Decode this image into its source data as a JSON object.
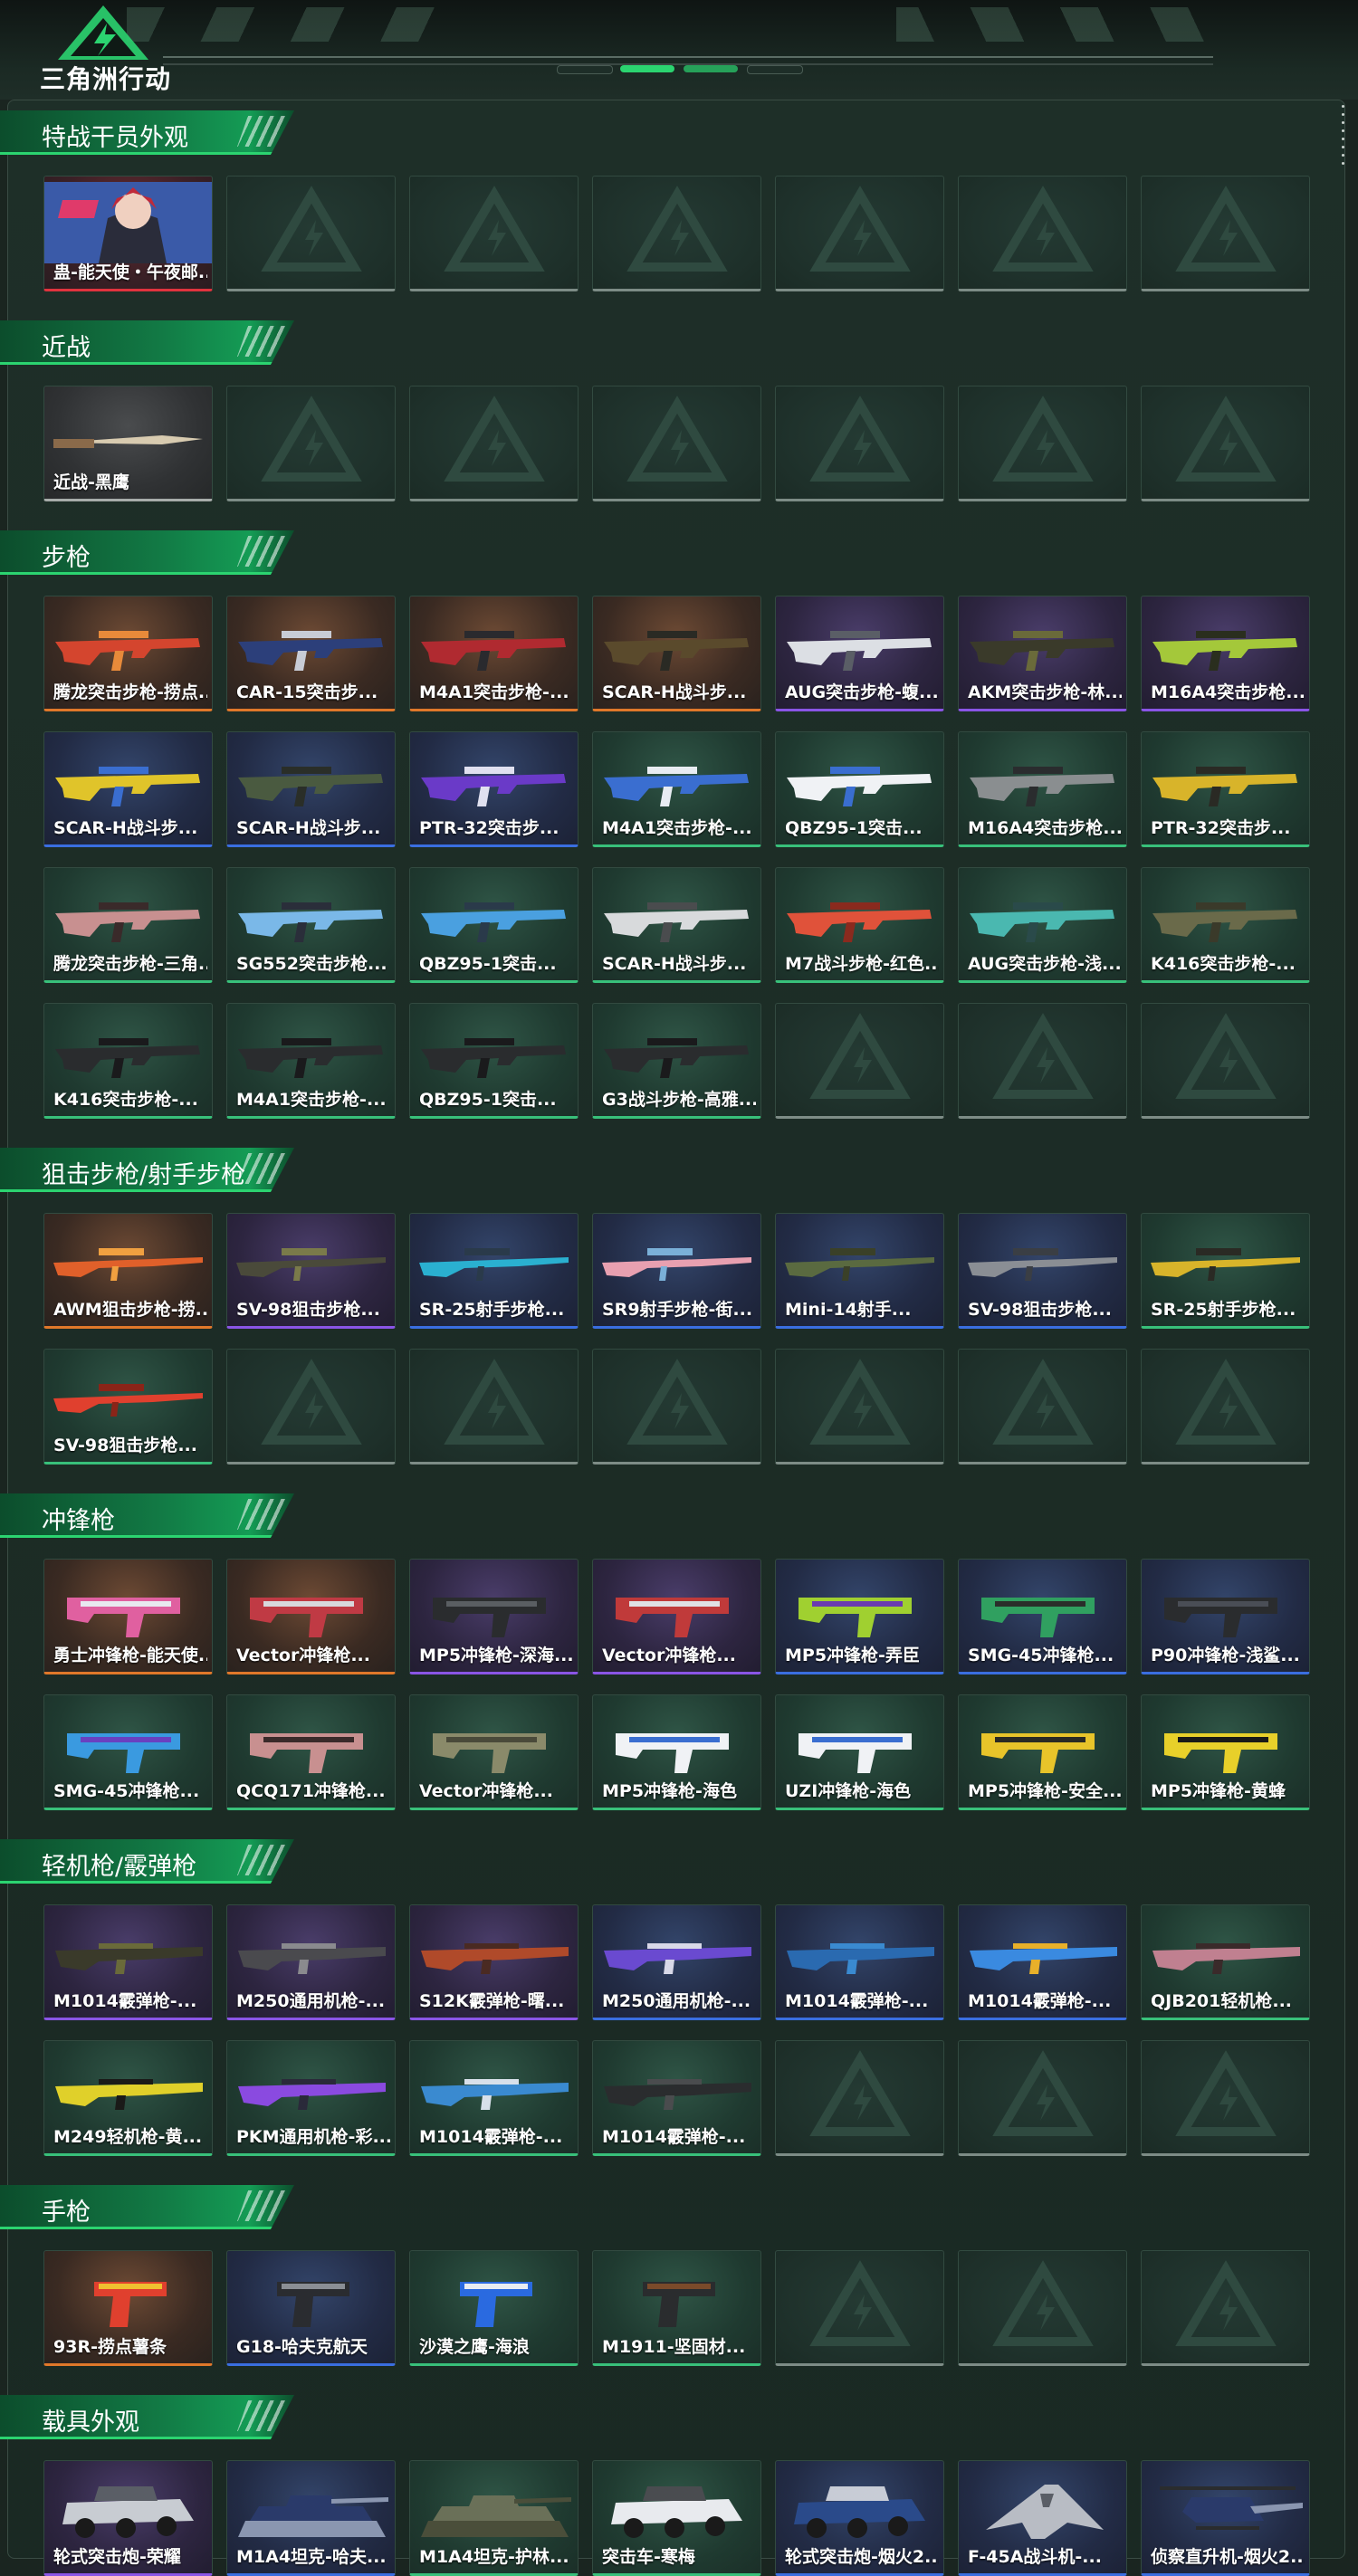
{
  "app": {
    "logo_text": "三角洲行动",
    "colors": {
      "accent": "#2bd470",
      "background": "#1a2520"
    }
  },
  "rarity_colors": {
    "orange": "#e0782a",
    "purple": "#8a55e6",
    "blue": "#3a6ee0",
    "green": "#38c07a",
    "red": "#e0333e",
    "gray": "#a7acaa",
    "empty": "#7d8c86"
  },
  "sections": [
    {
      "title": "特战干员外观",
      "slots": 7,
      "items": [
        {
          "name": "蛊-能天使・午夜邮...",
          "rarity": "red",
          "icon": "operator-portrait-icon"
        }
      ]
    },
    {
      "title": "近战",
      "slots": 7,
      "items": [
        {
          "name": "近战-黑鹰",
          "rarity": "gray",
          "icon": "knife-icon"
        }
      ]
    },
    {
      "title": "步枪",
      "slots": 28,
      "items": [
        {
          "name": "腾龙突击步枪-捞点...",
          "rarity": "orange",
          "icon": "rifle-icon",
          "colors": [
            "#d4452e",
            "#e88a3a"
          ]
        },
        {
          "name": "CAR-15突击步...",
          "rarity": "orange",
          "icon": "rifle-icon",
          "colors": [
            "#2c3f7a",
            "#c8ccd6"
          ]
        },
        {
          "name": "M4A1突击步枪-...",
          "rarity": "orange",
          "icon": "rifle-icon",
          "colors": [
            "#b02a30",
            "#2a2a2e"
          ]
        },
        {
          "name": "SCAR-H战斗步...",
          "rarity": "orange",
          "icon": "rifle-icon",
          "colors": [
            "#5a4a2c",
            "#2a2a24"
          ]
        },
        {
          "name": "AUG突击步枪-蝮...",
          "rarity": "purple",
          "icon": "rifle-icon",
          "colors": [
            "#dcdfe4",
            "#5a5e66"
          ]
        },
        {
          "name": "AKM突击步枪-林...",
          "rarity": "purple",
          "icon": "rifle-icon",
          "colors": [
            "#3a3a2a",
            "#6a6a3a"
          ]
        },
        {
          "name": "M16A4突击步枪...",
          "rarity": "purple",
          "icon": "rifle-icon",
          "colors": [
            "#a4c83a",
            "#2a2e1e"
          ]
        },
        {
          "name": "SCAR-H战斗步...",
          "rarity": "blue",
          "icon": "rifle-icon",
          "colors": [
            "#e0c42a",
            "#3a6ed0"
          ]
        },
        {
          "name": "SCAR-H战斗步...",
          "rarity": "blue",
          "icon": "rifle-icon",
          "colors": [
            "#4a5a40",
            "#2a2e28"
          ]
        },
        {
          "name": "PTR-32突击步...",
          "rarity": "blue",
          "icon": "rifle-icon",
          "colors": [
            "#6a3ac8",
            "#e0e0f0"
          ]
        },
        {
          "name": "M4A1突击步枪-...",
          "rarity": "green",
          "icon": "rifle-icon",
          "colors": [
            "#3a6ed0",
            "#e8ecf2"
          ]
        },
        {
          "name": "QBZ95-1突击...",
          "rarity": "green",
          "icon": "rifle-icon",
          "colors": [
            "#f0f2f5",
            "#3a6ed0"
          ]
        },
        {
          "name": "M16A4突击步枪...",
          "rarity": "green",
          "icon": "rifle-icon",
          "colors": [
            "#8a8e90",
            "#2a2c2e"
          ]
        },
        {
          "name": "PTR-32突击步...",
          "rarity": "green",
          "icon": "rifle-icon",
          "colors": [
            "#d8b42a",
            "#2a2a24"
          ]
        },
        {
          "name": "腾龙突击步枪-三角...",
          "rarity": "green",
          "icon": "rifle-icon",
          "colors": [
            "#c89090",
            "#3a2a2a"
          ]
        },
        {
          "name": "SG552突击步枪...",
          "rarity": "green",
          "icon": "rifle-icon",
          "colors": [
            "#7ab8e8",
            "#2a2e3a"
          ]
        },
        {
          "name": "QBZ95-1突击...",
          "rarity": "green",
          "icon": "rifle-icon",
          "colors": [
            "#4aa0e0",
            "#2a3a4a"
          ]
        },
        {
          "name": "SCAR-H战斗步...",
          "rarity": "green",
          "icon": "rifle-icon",
          "colors": [
            "#d8dadc",
            "#4a4c4e"
          ]
        },
        {
          "name": "M7战斗步枪-红色...",
          "rarity": "green",
          "icon": "rifle-icon",
          "colors": [
            "#e0523a",
            "#8a2a1e"
          ]
        },
        {
          "name": "AUG突击步枪-浅...",
          "rarity": "green",
          "icon": "rifle-icon",
          "colors": [
            "#4ab8b0",
            "#2a4a4a"
          ]
        },
        {
          "name": "K416突击步枪-...",
          "rarity": "green",
          "icon": "rifle-icon",
          "colors": [
            "#6a6a4a",
            "#3a3a2a"
          ]
        },
        {
          "name": "K416突击步枪-...",
          "rarity": "green",
          "icon": "rifle-icon",
          "colors": [
            "#2a2c2e",
            "#1a1a1c"
          ]
        },
        {
          "name": "M4A1突击步枪-...",
          "rarity": "green",
          "icon": "rifle-icon",
          "colors": [
            "#2a2c2e",
            "#1a1a1c"
          ]
        },
        {
          "name": "QBZ95-1突击...",
          "rarity": "green",
          "icon": "rifle-icon",
          "colors": [
            "#2a2c2e",
            "#1a1a1c"
          ]
        },
        {
          "name": "G3战斗步枪-高雅...",
          "rarity": "green",
          "icon": "rifle-icon",
          "colors": [
            "#2a2c2e",
            "#1a1a1c"
          ]
        }
      ]
    },
    {
      "title": "狙击步枪/射手步枪",
      "slots": 14,
      "items": [
        {
          "name": "AWM狙击步枪-捞...",
          "rarity": "orange",
          "icon": "sniper-rifle-icon",
          "colors": [
            "#e0602a",
            "#f0a040"
          ]
        },
        {
          "name": "SV-98狙击步枪...",
          "rarity": "purple",
          "icon": "sniper-rifle-icon",
          "colors": [
            "#4a4a3a",
            "#7a7a4a"
          ]
        },
        {
          "name": "SR-25射手步枪...",
          "rarity": "blue",
          "icon": "sniper-rifle-icon",
          "colors": [
            "#2ab0d0",
            "#2a3a4a"
          ]
        },
        {
          "name": "SR9射手步枪-街...",
          "rarity": "blue",
          "icon": "sniper-rifle-icon",
          "colors": [
            "#e8a0b0",
            "#7ab0d8"
          ]
        },
        {
          "name": "Mini-14射手...",
          "rarity": "blue",
          "icon": "sniper-rifle-icon",
          "colors": [
            "#5a6a40",
            "#3a4028"
          ]
        },
        {
          "name": "SV-98狙击步枪...",
          "rarity": "blue",
          "icon": "sniper-rifle-icon",
          "colors": [
            "#8a8e94",
            "#3a3e44"
          ]
        },
        {
          "name": "SR-25射手步枪...",
          "rarity": "green",
          "icon": "sniper-rifle-icon",
          "colors": [
            "#d8b42a",
            "#2a2a24"
          ]
        },
        {
          "name": "SV-98狙击步枪...",
          "rarity": "green",
          "icon": "sniper-rifle-icon",
          "colors": [
            "#e0402e",
            "#8a2418"
          ]
        }
      ]
    },
    {
      "title": "冲锋枪",
      "slots": 14,
      "items": [
        {
          "name": "勇士冲锋枪-能天使...",
          "rarity": "orange",
          "icon": "smg-icon",
          "colors": [
            "#e060a0",
            "#e8e8f0"
          ]
        },
        {
          "name": "Vector冲锋枪...",
          "rarity": "orange",
          "icon": "smg-icon",
          "colors": [
            "#c03a44",
            "#d8d8dc"
          ]
        },
        {
          "name": "MP5冲锋枪-深海...",
          "rarity": "purple",
          "icon": "smg-icon",
          "colors": [
            "#2a2c2e",
            "#5a5e62"
          ]
        },
        {
          "name": "Vector冲锋枪...",
          "rarity": "purple",
          "icon": "smg-icon",
          "colors": [
            "#c03a3a",
            "#e0e0e4"
          ]
        },
        {
          "name": "MP5冲锋枪-弄臣",
          "rarity": "blue",
          "icon": "smg-icon",
          "colors": [
            "#a0d030",
            "#6a3ab0"
          ]
        },
        {
          "name": "SMG-45冲锋枪...",
          "rarity": "blue",
          "icon": "smg-icon",
          "colors": [
            "#30a060",
            "#2a2e2a"
          ]
        },
        {
          "name": "P90冲锋枪-浅鲨...",
          "rarity": "blue",
          "icon": "smg-icon",
          "colors": [
            "#2a2c2e",
            "#4a4e56"
          ]
        },
        {
          "name": "SMG-45冲锋枪...",
          "rarity": "green",
          "icon": "smg-icon",
          "colors": [
            "#3a9ae0",
            "#6a40c0"
          ]
        },
        {
          "name": "QCQ171冲锋枪...",
          "rarity": "green",
          "icon": "smg-icon",
          "colors": [
            "#c89090",
            "#3a2a2a"
          ]
        },
        {
          "name": "Vector冲锋枪...",
          "rarity": "green",
          "icon": "smg-icon",
          "colors": [
            "#8a8a6a",
            "#4a4a3a"
          ]
        },
        {
          "name": "MP5冲锋枪-海色",
          "rarity": "green",
          "icon": "smg-icon",
          "colors": [
            "#f0f2f5",
            "#3a6ed0"
          ]
        },
        {
          "name": "UZI冲锋枪-海色",
          "rarity": "green",
          "icon": "smg-icon",
          "colors": [
            "#f0f2f5",
            "#3a6ed0"
          ]
        },
        {
          "name": "MP5冲锋枪-安全...",
          "rarity": "green",
          "icon": "smg-icon",
          "colors": [
            "#e8c42a",
            "#2a2a24"
          ]
        },
        {
          "name": "MP5冲锋枪-黄蜂",
          "rarity": "green",
          "icon": "smg-icon",
          "colors": [
            "#e8d02a",
            "#1a1a18"
          ]
        }
      ]
    },
    {
      "title": "轻机枪/霰弹枪",
      "slots": 14,
      "items": [
        {
          "name": "M1014霰弹枪-...",
          "rarity": "purple",
          "icon": "shotgun-icon",
          "colors": [
            "#3a3a2a",
            "#6a6a3a"
          ]
        },
        {
          "name": "M250通用机枪-...",
          "rarity": "purple",
          "icon": "machine-gun-icon",
          "colors": [
            "#4a4a4e",
            "#8a8a8e"
          ]
        },
        {
          "name": "S12K霰弹枪-曙...",
          "rarity": "purple",
          "icon": "shotgun-icon",
          "colors": [
            "#b04a2a",
            "#4a2a22"
          ]
        },
        {
          "name": "M250通用机枪-...",
          "rarity": "blue",
          "icon": "machine-gun-icon",
          "colors": [
            "#6a4ad0",
            "#d8d8e8"
          ]
        },
        {
          "name": "M1014霰弹枪-...",
          "rarity": "blue",
          "icon": "shotgun-icon",
          "colors": [
            "#2a6ab0",
            "#3a8ad0"
          ]
        },
        {
          "name": "M1014霰弹枪-...",
          "rarity": "blue",
          "icon": "shotgun-icon",
          "colors": [
            "#3a8ae0",
            "#e8b02a"
          ]
        },
        {
          "name": "QJB201轻机枪...",
          "rarity": "green",
          "icon": "machine-gun-icon",
          "colors": [
            "#c08090",
            "#3a2a2a"
          ]
        },
        {
          "name": "M249轻机枪-黄...",
          "rarity": "green",
          "icon": "machine-gun-icon",
          "colors": [
            "#e0d02a",
            "#1a1a18"
          ]
        },
        {
          "name": "PKM通用机枪-彩...",
          "rarity": "green",
          "icon": "machine-gun-icon",
          "colors": [
            "#8a4ae0",
            "#2a2a3a"
          ]
        },
        {
          "name": "M1014霰弹枪-...",
          "rarity": "green",
          "icon": "shotgun-icon",
          "colors": [
            "#3a8ad0",
            "#d8e0ea"
          ]
        },
        {
          "name": "M1014霰弹枪-...",
          "rarity": "green",
          "icon": "shotgun-icon",
          "colors": [
            "#2a2c2e",
            "#4a4c4e"
          ]
        }
      ]
    },
    {
      "title": "手枪",
      "slots": 7,
      "items": [
        {
          "name": "93R-捞点薯条",
          "rarity": "orange",
          "icon": "pistol-icon",
          "colors": [
            "#e0402e",
            "#f0c030"
          ]
        },
        {
          "name": "G18-哈夫克航天",
          "rarity": "blue",
          "icon": "pistol-icon",
          "colors": [
            "#2a2c30",
            "#8a8e94"
          ]
        },
        {
          "name": "沙漠之鹰-海浪",
          "rarity": "green",
          "icon": "pistol-icon",
          "colors": [
            "#2a6ae0",
            "#e8ecf2"
          ]
        },
        {
          "name": "M1911-坚固材...",
          "rarity": "green",
          "icon": "pistol-icon",
          "colors": [
            "#2a2c2e",
            "#7a4a2a"
          ]
        }
      ]
    },
    {
      "title": "载具外观",
      "slots": 7,
      "items": [
        {
          "name": "轮式突击炮-荣耀",
          "rarity": "purple",
          "icon": "armored-car-icon",
          "colors": [
            "#c8ccd2",
            "#5a5e66"
          ]
        },
        {
          "name": "M1A4坦克-哈夫...",
          "rarity": "blue",
          "icon": "tank-icon",
          "colors": [
            "#2a3a6a",
            "#8a96b0"
          ]
        },
        {
          "name": "M1A4坦克-护林...",
          "rarity": "green",
          "icon": "tank-icon",
          "colors": [
            "#6a7058",
            "#4a4e3a"
          ]
        },
        {
          "name": "突击车-寒梅",
          "rarity": "green",
          "icon": "assault-vehicle-icon",
          "colors": [
            "#e8eaee",
            "#4a4c50"
          ]
        },
        {
          "name": "轮式突击炮-烟火2...",
          "rarity": "blue",
          "icon": "armored-car-icon",
          "colors": [
            "#2a4a8a",
            "#c8ccd6"
          ]
        },
        {
          "name": "F-45A战斗机-...",
          "rarity": "blue",
          "icon": "jet-icon",
          "colors": [
            "#b8bcc4",
            "#5a5e66"
          ]
        },
        {
          "name": "侦察直升机-烟火2...",
          "rarity": "blue",
          "icon": "helicopter-icon",
          "colors": [
            "#2a3a6a",
            "#8a96b0"
          ]
        }
      ]
    }
  ]
}
